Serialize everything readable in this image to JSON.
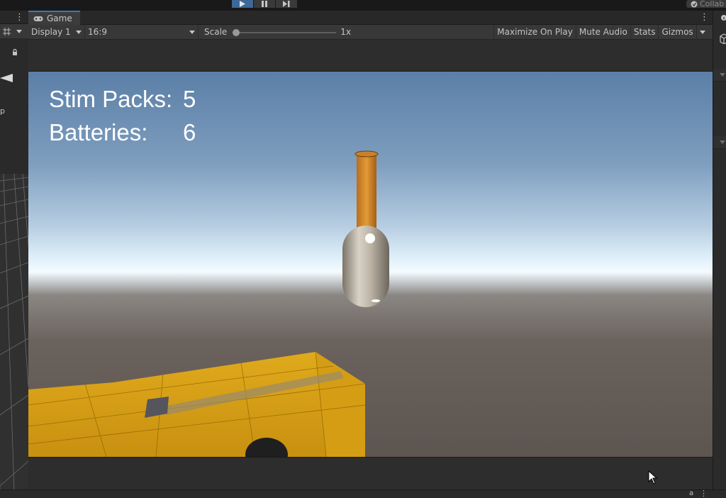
{
  "toolbar": {
    "play_icon": "play-icon",
    "pause_icon": "pause-icon",
    "step_icon": "step-icon",
    "collab_label": "Collab"
  },
  "game_window": {
    "tab_label": "Game",
    "tab_icon": "gamepad-icon",
    "display_label": "Display 1",
    "aspect_label": "16:9",
    "scale_label": "Scale",
    "scale_value": "1x",
    "maximize_label": "Maximize On Play",
    "mute_label": "Mute Audio",
    "stats_label": "Stats",
    "gizmos_label": "Gizmos"
  },
  "left_panel": {
    "cut_label": "p"
  },
  "hud": {
    "stim_label": "Stim Packs:",
    "stim_value": "5",
    "battery_label": "Batteries:",
    "battery_value": "6"
  },
  "status_bar": {
    "right_text": "a"
  },
  "colors": {
    "accent": "#3a79bb",
    "play_active": "#3d6898",
    "crate": "#d8a017",
    "bottle_neck": "#d08a2a",
    "bottle_body": "#c8c0b2"
  }
}
